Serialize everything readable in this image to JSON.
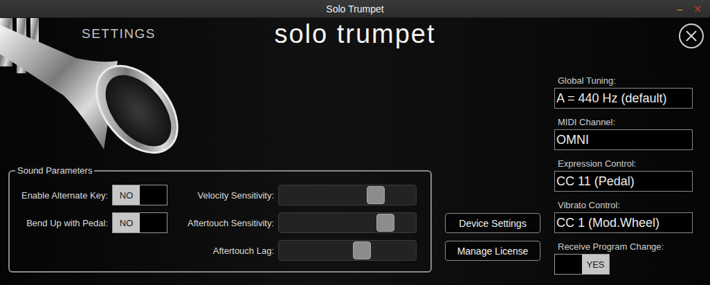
{
  "window": {
    "title": "Solo Trumpet",
    "controls": [
      "–",
      "✕"
    ]
  },
  "header": {
    "section": "SETTINGS",
    "title": "solo trumpet"
  },
  "sound_parameters": {
    "title": "Sound Parameters",
    "toggles": [
      {
        "label": "Enable Alternate Key:",
        "value": "NO",
        "on": false
      },
      {
        "label": "Bend Up with Pedal:",
        "value": "NO",
        "on": false
      }
    ],
    "sliders": [
      {
        "label": "Velocity Sensitivity:",
        "level": 0.74
      },
      {
        "label": "Aftertouch Sensitivity:",
        "level": 0.82
      },
      {
        "label": "Aftertouch Lag:",
        "level": 0.62
      }
    ]
  },
  "buttons": [
    "Device Settings",
    "Manage License"
  ],
  "fields": [
    {
      "label": "Global Tuning:",
      "value": "A = 440 Hz (default)"
    },
    {
      "label": "MIDI Channel:",
      "value": "OMNI"
    },
    {
      "label": "Expression Control:",
      "value": "CC 11 (Pedal)"
    },
    {
      "label": "Vibrato Control:",
      "value": "CC 1 (Mod.Wheel)"
    }
  ],
  "program_change": {
    "label": "Receive Program Change:",
    "value": "YES",
    "on": true
  }
}
